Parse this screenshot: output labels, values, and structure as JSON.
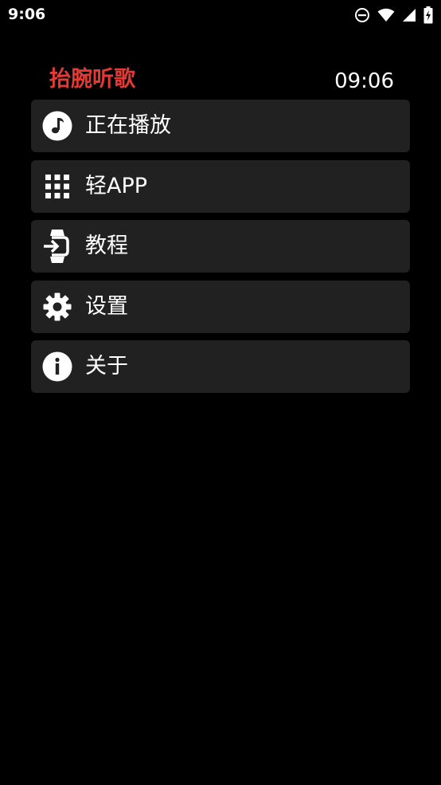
{
  "status_bar": {
    "time": "9:06",
    "icons": [
      "do-not-disturb-icon",
      "wifi-icon",
      "cell-signal-icon",
      "battery-charging-icon"
    ]
  },
  "header": {
    "title": "抬腕听歌",
    "title_color": "#e53935",
    "clock": "09:06"
  },
  "menu": {
    "items": [
      {
        "label": "正在播放",
        "icon": "music-note-icon"
      },
      {
        "label": "轻APP",
        "icon": "apps-grid-icon"
      },
      {
        "label": "教程",
        "icon": "watch-login-icon"
      },
      {
        "label": "设置",
        "icon": "gear-icon"
      },
      {
        "label": "关于",
        "icon": "info-icon"
      }
    ]
  },
  "colors": {
    "background": "#000000",
    "item_background": "#212121",
    "text": "#ffffff"
  }
}
